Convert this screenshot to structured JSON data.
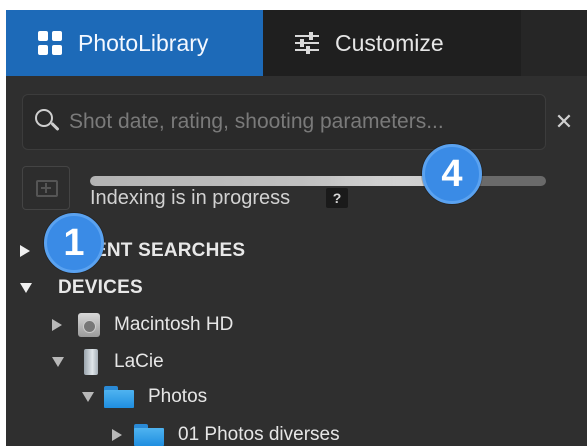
{
  "tabs": [
    {
      "label": "PhotoLibrary",
      "icon": "grid-icon",
      "active": true
    },
    {
      "label": "Customize",
      "icon": "sliders-icon",
      "active": false
    }
  ],
  "search": {
    "placeholder": "Shot date, rating, shooting parameters..."
  },
  "indexing": {
    "label": "Indexing is in progress",
    "help": "?",
    "progress": 0.75
  },
  "tree": {
    "recent_searches": "ENT SEARCHES",
    "devices": "DEVICES",
    "items": [
      {
        "label": "Macintosh HD",
        "icon": "hard-drive-icon"
      },
      {
        "label": "LaCie",
        "icon": "external-drive-icon"
      },
      {
        "label": "Photos",
        "icon": "folder-icon"
      },
      {
        "label": "01 Photos diverses",
        "icon": "folder-icon"
      }
    ]
  },
  "callouts": [
    "1",
    "4"
  ],
  "colors": {
    "accent": "#1d6ab8",
    "callout": "#3a8be6",
    "background": "#2f2f2f"
  }
}
